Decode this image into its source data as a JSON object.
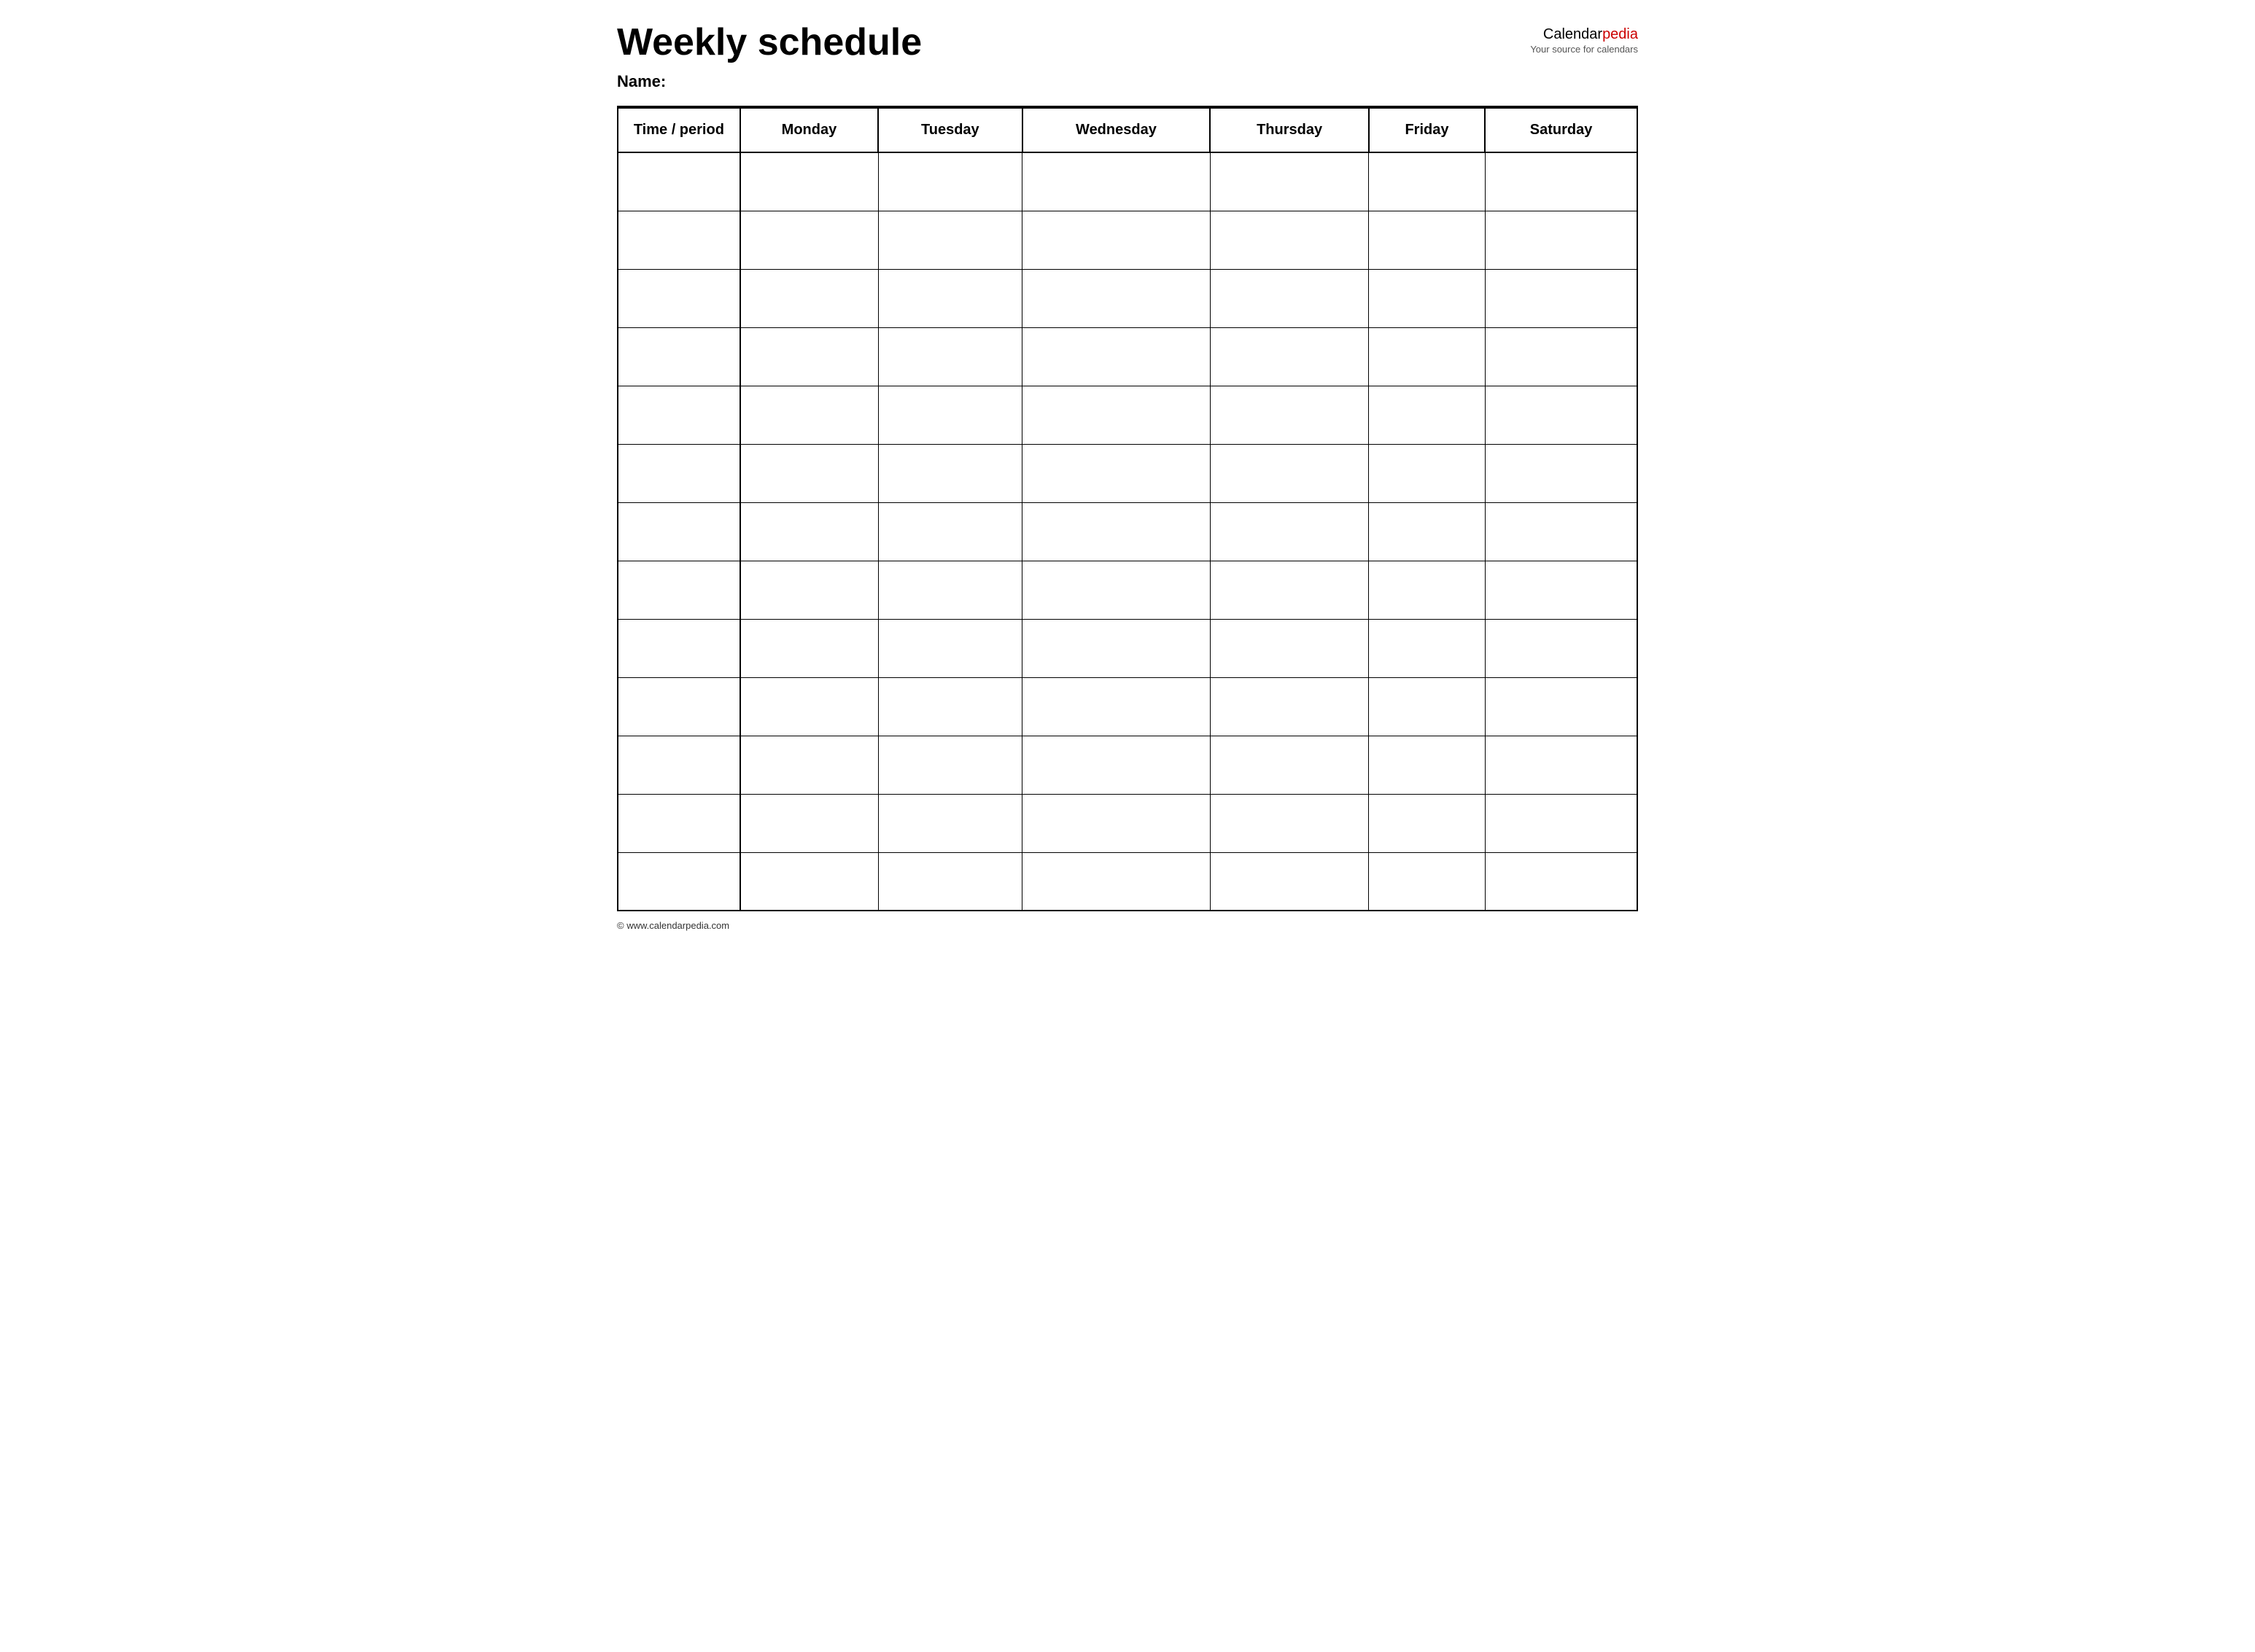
{
  "header": {
    "title": "Weekly schedule",
    "name_label": "Name:",
    "logo_calendar": "Calendar",
    "logo_pedia": "pedia",
    "logo_tagline": "Your source for calendars"
  },
  "table": {
    "columns": [
      "Time / period",
      "Monday",
      "Tuesday",
      "Wednesday",
      "Thursday",
      "Friday",
      "Saturday"
    ],
    "row_count": 13
  },
  "footer": {
    "url": "© www.calendarpedia.com"
  }
}
